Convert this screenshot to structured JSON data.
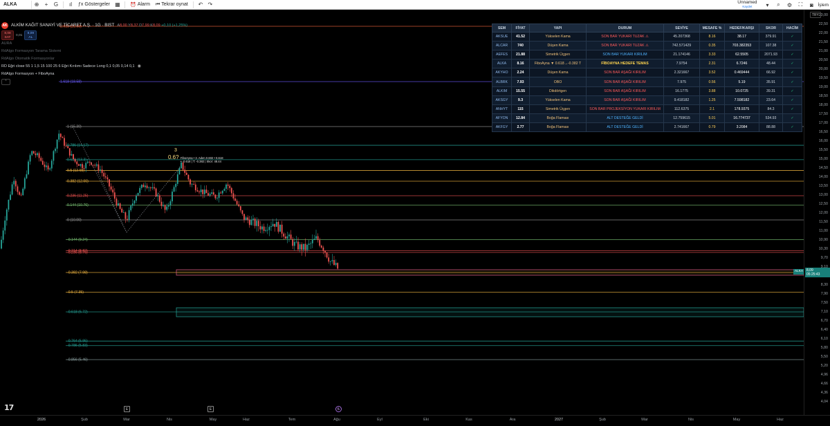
{
  "toolbar": {
    "symbol": "ALKA",
    "indicators_label": "Göstergeler",
    "alert_label": "Alarm",
    "replay_label": "Tekrar oynat",
    "layout_name": "Unnamed",
    "layout_status": "Kaydet",
    "trade_label": "İşlem"
  },
  "legend": {
    "logo_text": "AK",
    "title": "ALKİM KAĞIT SANAYİ VE TİCARET A.Ş. · 1G · BIST",
    "ohlc": {
      "o_label": "A",
      "o": "8,00",
      "h_label": "Y",
      "h": "8,37",
      "l_label": "D",
      "l": "7,99",
      "c_label": "K",
      "c": "8,09",
      "change": "+0,10 (+1,25%)"
    },
    "sell_price": "8,08",
    "sell_label": "SAT",
    "spread": "0,01",
    "buy_price": "8,09",
    "buy_label": "AL",
    "indicators": [
      "AURA",
      "RdAlgo Formasyon Tarama Sistemi",
      "RdAlgo Otomatik Formasyonlar",
      "RD Eğri close 55 1 1,5 15 100 25 6 Eğri Kırılımı Sadece Long 0,1 0,05 0,14 0,1"
    ],
    "active_indicator": "RdAlgo Formasyon + FiboAyna"
  },
  "chart": {
    "fib_levels": [
      {
        "label": "2.618",
        "value": "21.88",
        "price": 21.88,
        "color": "#f5643c"
      },
      {
        "label": "1.618",
        "value": "18.58",
        "price": 18.58,
        "color": "#6a5cff"
      },
      {
        "label": "1",
        "value": "15.30",
        "price": 15.3,
        "color": "#9e9e9e"
      },
      {
        "label": "0.786",
        "value": "14.17",
        "price": 14.17,
        "color": "#26a69a"
      },
      {
        "label": "0.618",
        "value": "13.3",
        "price": 13.3,
        "color": "#26a69a"
      },
      {
        "label": "0.5",
        "value": "12.65",
        "price": 12.65,
        "color": "#f5b942"
      },
      {
        "label": "0.382",
        "value": "12.00",
        "price": 12.0,
        "color": "#f5b942"
      },
      {
        "label": "0.236",
        "value": "11.25",
        "price": 11.25,
        "color": "#ef5350"
      },
      {
        "label": "0.144",
        "value": "10.76",
        "price": 10.76,
        "color": "#7cc576"
      },
      {
        "label": "0",
        "value": "10.00",
        "price": 10.0,
        "color": "#9e9e9e"
      },
      {
        "label": "-0.144",
        "value": "9.24",
        "price": 9.24,
        "color": "#7cc576"
      },
      {
        "label": "-0.214",
        "value": "8.82",
        "price": 8.82,
        "color": "#ef5350"
      },
      {
        "label": "-0.236",
        "value": "8.75",
        "price": 8.75,
        "color": "#ef5350"
      },
      {
        "label": "-0.382",
        "value": "7.98",
        "price": 7.98,
        "color": "#f5b942"
      },
      {
        "label": "-0.5",
        "value": "7.35",
        "price": 7.35,
        "color": "#f5b942"
      },
      {
        "label": "-0.618",
        "value": "6.72",
        "price": 6.72,
        "color": "#26a69a"
      },
      {
        "label": "-0.764",
        "value": "5.95",
        "price": 5.95,
        "color": "#26a69a"
      },
      {
        "label": "-0.786",
        "value": "5.83",
        "price": 5.83,
        "color": "#26a69a"
      },
      {
        "label": "-0.856",
        "value": "5.46",
        "price": 5.46,
        "color": "#8ea4a4"
      }
    ],
    "pattern_label_number": "3",
    "pattern_label_ratio": "0.6?",
    "pattern_tooltip_line1": "FiboAyna • 3. Adım 0.602 • 0.618",
    "pattern_tooltip_line2": "• -0.618 | T: -0.382 | Skor: 48.44",
    "current_symbol_tag": "ALKA",
    "current_price": "8,09",
    "current_countdown": "05:25:43",
    "currency": "TRY"
  },
  "price_axis": [
    "23,00",
    "22,50",
    "22,00",
    "21,50",
    "21,00",
    "20,50",
    "20,00",
    "19,50",
    "19,00",
    "18,50",
    "18,00",
    "17,50",
    "17,00",
    "16,50",
    "16,00",
    "15,50",
    "15,00",
    "14,50",
    "14,00",
    "13,50",
    "13,00",
    "12,50",
    "12,00",
    "11,50",
    "11,00",
    "10,90",
    "10,30",
    "9,70",
    "9,10",
    "8,70",
    "8,30",
    "7,90",
    "7,50",
    "7,10",
    "6,70",
    "6,40",
    "6,10",
    "5,80",
    "5,50",
    "5,20",
    "4,96",
    "4,66",
    "4,36",
    "4,04"
  ],
  "time_axis": [
    "2026",
    "Şub",
    "Mar",
    "Nis",
    "May",
    "Haz",
    "Tem",
    "Ağu",
    "Eyl",
    "Eki",
    "Kas",
    "Ara",
    "2027",
    "Şub",
    "Mar",
    "Nis",
    "May",
    "Haz"
  ],
  "events": [
    "E",
    "E",
    "₺"
  ],
  "table": {
    "headers": [
      "SEM",
      "FİYAT",
      "YAPI",
      "DURUM",
      "SEVİYE",
      "MESAFE %",
      "HEDEF/KARŞI",
      "SKOR",
      "HACİM"
    ],
    "rows": [
      {
        "sem": "AKSUE",
        "fiyat": "41.52",
        "yapi": "Yükselen Kama",
        "durum": "SON BAR YUKARI TUZAK ⚠",
        "tone": "red",
        "seviye": "45.207368",
        "mesafe": "8.16",
        "hedef": "38.17",
        "skor": "379.91",
        "hacim": "✓"
      },
      {
        "sem": "ALCAR",
        "fiyat": "740",
        "yapi": "Düşen Kama",
        "durum": "SON BAR YUKARI TUZAK ⚠",
        "tone": "red",
        "seviye": "742.571429",
        "mesafe": "0.35",
        "hedef": "703.382353",
        "skor": "107.38",
        "hacim": "✓"
      },
      {
        "sem": "AEFES",
        "fiyat": "21.88",
        "yapi": "Simetrik Üçgen",
        "durum": "SON BAR YUKARI KIRILIM",
        "tone": "blue",
        "seviye": "21.174146",
        "mesafe": "3.33",
        "hedef": "62.5505",
        "skor": "2071.93",
        "hacim": "✓"
      },
      {
        "sem": "ALKA",
        "fiyat": "8.16",
        "yapi": "FiboAyna ▼ 0.618→-0.382 T",
        "durum": "FİBOAYNA HEDEFE TEMAS",
        "tone": "yellow",
        "seviye": "7.9754",
        "mesafe": "2.31",
        "hedef": "6.7246",
        "skor": "48.44",
        "hacim": "✓"
      },
      {
        "sem": "AKYHO",
        "fiyat": "2.24",
        "yapi": "Düşen Kama",
        "durum": "SON BAR AŞAĞI KIRILIM",
        "tone": "red",
        "seviye": "2.321667",
        "mesafe": "3.52",
        "hedef": "0.469444",
        "skor": "66.92",
        "hacim": "✓"
      },
      {
        "sem": "ALBRK",
        "fiyat": "7.93",
        "yapi": "OBO",
        "durum": "SON BAR AŞAĞI KIRILIM",
        "tone": "red",
        "seviye": "7.975",
        "mesafe": "0.56",
        "hedef": "5.19",
        "skor": "35.91",
        "hacim": "✓"
      },
      {
        "sem": "ALKIM",
        "fiyat": "15.55",
        "yapi": "Dikdörtgen",
        "durum": "SON BAR AŞAĞI KIRILIM",
        "tone": "red",
        "seviye": "16.1775",
        "mesafe": "3.88",
        "hedef": "10.0725",
        "skor": "39.31",
        "hacim": "✓"
      },
      {
        "sem": "AKSGY",
        "fiyat": "9.3",
        "yapi": "Yükselen Kama",
        "durum": "SON BAR AŞAĞI KIRILIM",
        "tone": "red",
        "seviye": "9.418182",
        "mesafe": "1.25",
        "hedef": "7.598182",
        "skor": "23.64",
        "hacim": "✓"
      },
      {
        "sem": "ANHYT",
        "fiyat": "115",
        "yapi": "Simetrik Üçgen",
        "durum": "SON BAR PROJEKSİYON YUKARI KIRILIM",
        "tone": "red",
        "seviye": "112.6375",
        "mesafe": "2.1",
        "hedef": "178.9375",
        "skor": "84.3",
        "hacim": "✓"
      },
      {
        "sem": "AFYON",
        "fiyat": "12.84",
        "yapi": "Boğa Flaması",
        "durum": "ALT DESTEĞE GELDİ",
        "tone": "blue",
        "seviye": "12.759615",
        "mesafe": "5.01",
        "hedef": "16.774737",
        "skor": "534.93",
        "hacim": "✓"
      },
      {
        "sem": "AKFGY",
        "fiyat": "2.77",
        "yapi": "Boğa Flaması",
        "durum": "ALT DESTEĞE GELDİ",
        "tone": "blue",
        "seviye": "2.741667",
        "mesafe": "0.79",
        "hedef": "3.2084",
        "skor": "88.88",
        "hacim": "✓"
      }
    ]
  },
  "colors": {
    "up": "#26a69a",
    "down": "#ef5350",
    "accent": "#2962ff",
    "table_header": "#1b2a3d",
    "table_body": "#0c1624"
  }
}
